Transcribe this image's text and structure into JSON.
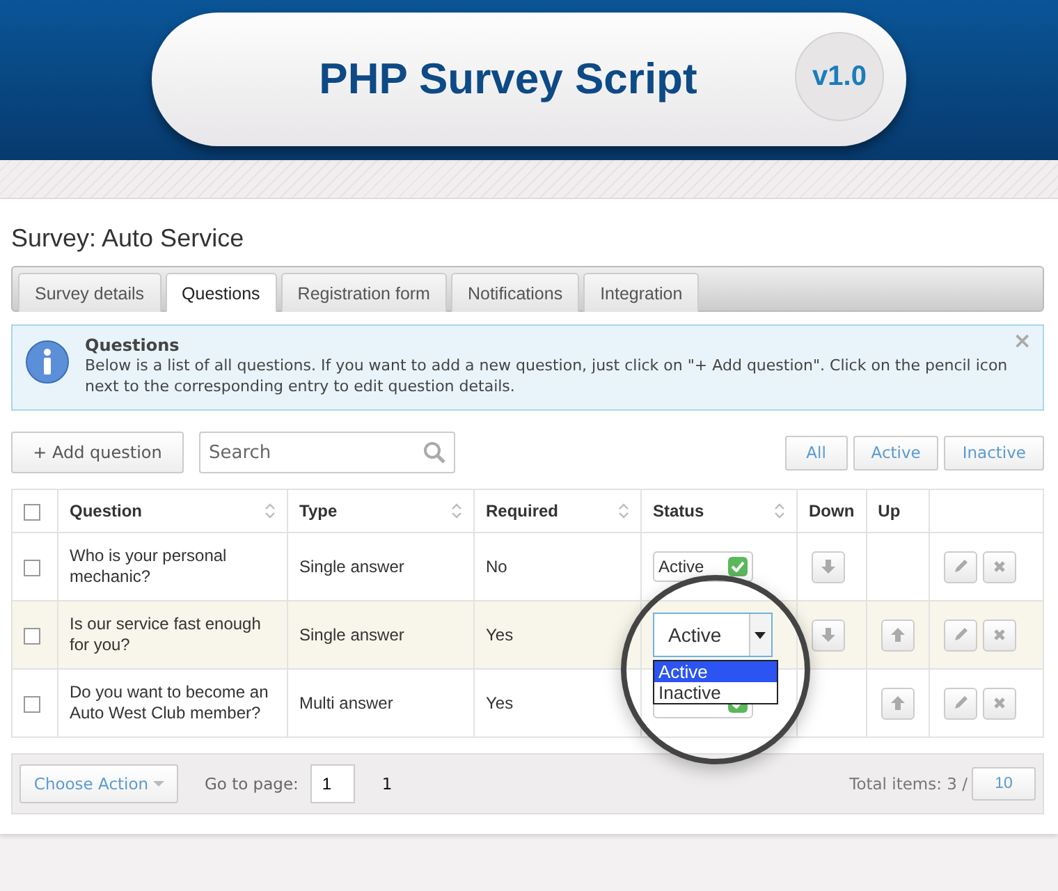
{
  "header": {
    "title": "PHP Survey Script",
    "version": "v1.0"
  },
  "page_title": "Survey: Auto Service",
  "tabs": [
    {
      "label": "Survey details",
      "selected": false
    },
    {
      "label": "Questions",
      "selected": true
    },
    {
      "label": "Registration form",
      "selected": false
    },
    {
      "label": "Notifications",
      "selected": false
    },
    {
      "label": "Integration",
      "selected": false
    }
  ],
  "info": {
    "title": "Questions",
    "text": "Below is a list of all questions. If you want to add a new question, just click on \"+ Add question\". Click on the pencil icon next to the corresponding entry to edit question details.",
    "close": "×"
  },
  "toolbar": {
    "add_button": "+ Add question",
    "search": {
      "placeholder": "Search"
    },
    "filters": [
      {
        "label": "All",
        "selected": false
      },
      {
        "label": "Active",
        "selected": false
      },
      {
        "label": "Inactive",
        "selected": false
      }
    ]
  },
  "table": {
    "select_all": {
      "checked": false
    },
    "columns": [
      {
        "label": "Question",
        "sortable": true
      },
      {
        "label": "Type",
        "sortable": true
      },
      {
        "label": "Required",
        "sortable": true
      },
      {
        "label": "Status",
        "sortable": true
      },
      {
        "label": "Down",
        "sortable": false
      },
      {
        "label": "Up",
        "sortable": false
      }
    ],
    "rows": [
      {
        "checked": false,
        "highlighted": false,
        "question": "Who is your personal mechanic?",
        "type": "Single answer",
        "required": "No",
        "status": {
          "kind": "badge",
          "label": "Active",
          "active": true
        },
        "down": true,
        "up": false
      },
      {
        "checked": false,
        "highlighted": true,
        "question": "Is our service fast enough for you?",
        "type": "Single answer",
        "required": "Yes",
        "status": {
          "kind": "select",
          "value": "Active",
          "options": [
            {
              "label": "Active",
              "selected": true
            },
            {
              "label": "Inactive",
              "selected": false
            }
          ]
        },
        "down": true,
        "up": true
      },
      {
        "checked": false,
        "highlighted": false,
        "question": "Do you want to become an Auto West Club member?",
        "type": "Multi answer",
        "required": "Yes",
        "status": {
          "kind": "badge",
          "active": true
        },
        "down": false,
        "up": true
      }
    ]
  },
  "footer": {
    "action_button": "Choose Action",
    "goto_label": "Go to page:",
    "page_value": "1",
    "page_link": "1",
    "total": "Total items: 3 /",
    "per_page": "10"
  }
}
